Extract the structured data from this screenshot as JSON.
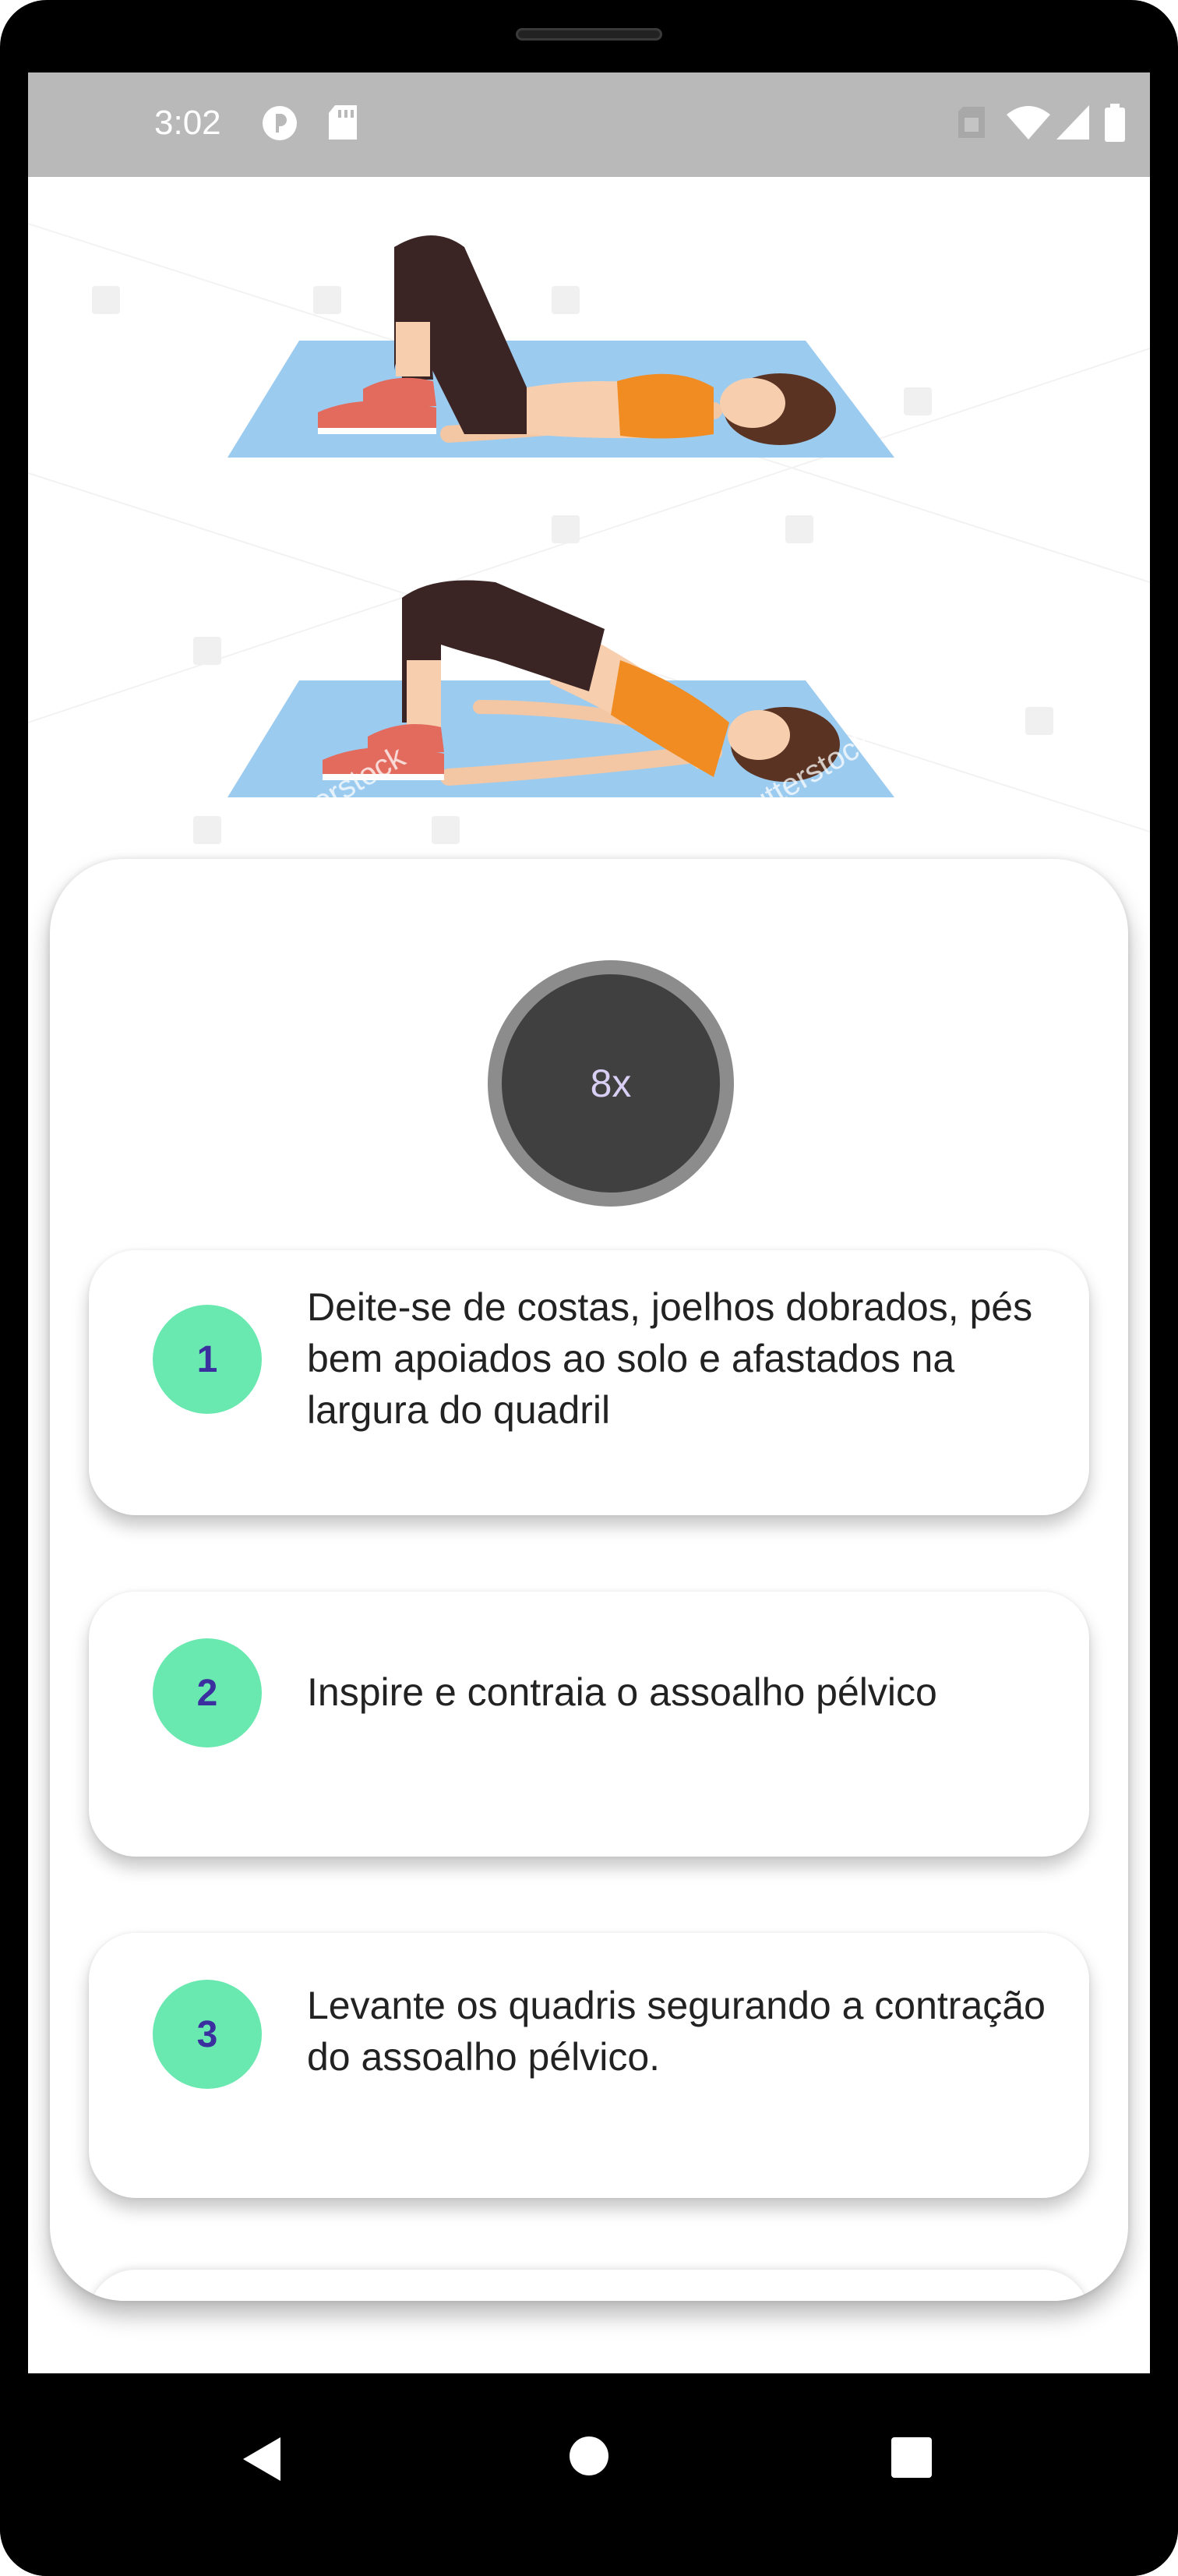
{
  "status_bar": {
    "time": "3:02",
    "icons": [
      "media-player-icon",
      "sd-card-icon",
      "sim-card-icon",
      "wifi-icon",
      "cellular-signal-icon",
      "battery-icon"
    ]
  },
  "illustration": {
    "subject": "glute-bridge-exercise",
    "watermark": "shutterstock"
  },
  "repetitions": {
    "label": "8x"
  },
  "steps": [
    {
      "number": "1",
      "text": "Deite-se de costas, joelhos dobrados, pés bem apoiados ao solo e afastados na largura do quadril"
    },
    {
      "number": "2",
      "text": "Inspire e contraia o assoalho pélvico"
    },
    {
      "number": "3",
      "text": "Levante os quadris segurando a contração do assoalho pélvico."
    }
  ],
  "nav": {
    "back_icon": "back-triangle-icon",
    "home_icon": "home-circle-icon",
    "recents_icon": "recents-square-icon"
  },
  "colors": {
    "status_bar": "#b9b9b9",
    "badge": "#69e8b0",
    "badge_text": "#3b2fa0",
    "rep_circle": "#404040",
    "rep_ring": "#8c8c8c",
    "mat": "#9ccbf0",
    "top": "#f08c22",
    "leggings": "#3a2424",
    "shoes": "#e26b5e"
  }
}
